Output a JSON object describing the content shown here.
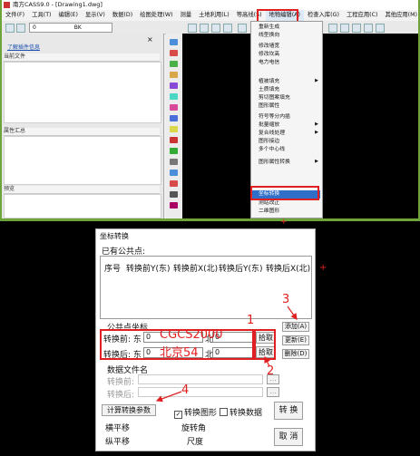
{
  "app": {
    "title": "南方CASS9.0 - [Drawing1.dwg]",
    "menu": [
      "文件(F)",
      "工具(T)",
      "编辑(E)",
      "显示(V)",
      "数据(D)",
      "绘图处理(W)",
      "测量",
      "土地利用(L)",
      "等高线(S)",
      "地物编辑(A)",
      "检查入库(G)",
      "工程应用(C)",
      "其他应用(M)"
    ],
    "active_menu": "地物编辑(A)",
    "layer_value": "0",
    "toolbar_text": "BK",
    "panel_link": "了解插件信息",
    "panel_sections": [
      "当前文件",
      "属性汇总",
      "预览"
    ]
  },
  "dropdown": {
    "items": [
      {
        "label": "重新生成",
        "arrow": false
      },
      {
        "label": "线型换向",
        "arrow": false
      },
      {
        "label": "修改墙宽",
        "arrow": false
      },
      {
        "label": "修改坎高",
        "arrow": false
      },
      {
        "label": "电力电信",
        "arrow": true
      },
      {
        "label": "植被填充",
        "arrow": true
      },
      {
        "label": "土质填充",
        "arrow": false
      },
      {
        "label": "剪切图案填充",
        "arrow": false
      },
      {
        "label": "图形属性",
        "arrow": false
      },
      {
        "label": "符号等分内插",
        "arrow": false
      },
      {
        "label": "批量缩放",
        "arrow": true
      },
      {
        "label": "复合线处理",
        "arrow": true
      },
      {
        "label": "图形接边",
        "arrow": false
      },
      {
        "label": "多个中心线",
        "arrow": false
      },
      {
        "label": "图形属性转换",
        "arrow": true
      },
      {
        "label": "坐标转换",
        "arrow": false
      },
      {
        "label": "测站改正",
        "arrow": false
      },
      {
        "label": "二维图形",
        "arrow": false
      }
    ],
    "highlighted": "坐标转换"
  },
  "dialog": {
    "title": "坐标转换",
    "common_points_label": "已有公共点:",
    "columns": [
      "序号",
      "转换前Y(东)",
      "转换前X(北)",
      "转换后Y(东)",
      "转换后X(北)"
    ],
    "common_coord_label": "公共点坐标",
    "before_label": "转换前: 东",
    "before_east": "0",
    "before_north_label": "北",
    "before_north": "0",
    "after_label": "转换后: 东",
    "after_east": "0",
    "after_north_label": "北",
    "after_north": "0",
    "pick1": "拾取",
    "pick2": "拾取",
    "add": "添加(A)",
    "update": "更新(E)",
    "delete": "删除(D)",
    "data_file_label": "数据文件名",
    "file_before_label": "转换前:",
    "file_after_label": "转换后:",
    "browse": "...",
    "calc_params": "计算转换参数",
    "chk_graphics": "转换图形",
    "chk_data": "转换数据",
    "convert": "转 换",
    "cancel": "取 消",
    "h_shift": "横平移",
    "v_shift": "纵平移",
    "rotation": "旋转角",
    "scale": "尺度"
  },
  "annotations": {
    "n1": "1",
    "n2": "2",
    "n3": "3",
    "n4": "4",
    "cgcs": "CGCS2000",
    "bj54": "北京54"
  },
  "colors": {
    "frame_green": "#6ea53a",
    "annotation_red": "#e02020",
    "highlight_blue": "#2f6fc8"
  }
}
